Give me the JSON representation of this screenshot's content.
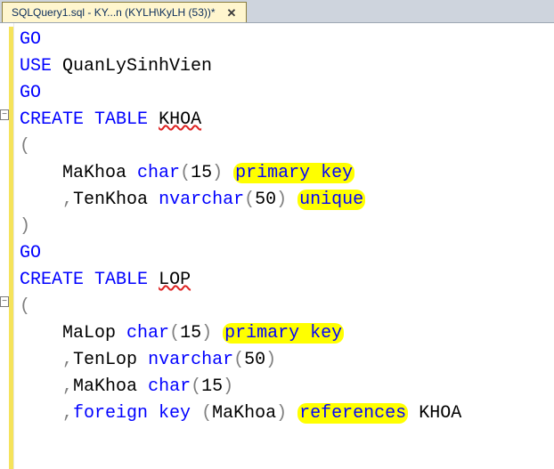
{
  "tab": {
    "label": "SQLQuery1.sql - KY...n (KYLH\\KyLH (53))*",
    "close_glyph": "✕"
  },
  "outline": {
    "collapse_glyph": "−"
  },
  "code": {
    "l1_go": "GO",
    "l2_use": "USE",
    "l2_db": "QuanLySinhVien",
    "l3_go": "GO",
    "l4_create": "CREATE",
    "l4_table": "TABLE",
    "l4_name": "KHOA",
    "l5_paren_open": "(",
    "l6_col": "MaKhoa",
    "l6_type": "char",
    "l6_len": "15",
    "l6_pk": "primary key",
    "l7_comma": ",",
    "l7_col": "TenKhoa",
    "l7_type": "nvarchar",
    "l7_len": "50",
    "l7_uq": "unique",
    "l8_paren_close": ")",
    "l9_go": "GO",
    "l10_create": "CREATE",
    "l10_table": "TABLE",
    "l10_name": "LOP",
    "l11_paren_open": "(",
    "l12_col": "MaLop",
    "l12_type": "char",
    "l12_len": "15",
    "l12_pk": "primary key",
    "l13_comma": ",",
    "l13_col": "TenLop",
    "l13_type": "nvarchar",
    "l13_len": "50",
    "l14_comma": ",",
    "l14_col": "MaKhoa",
    "l14_type": "char",
    "l14_len": "15",
    "l15_comma": ",",
    "l15_fk": "foreign key",
    "l15_po": "(",
    "l15_ref_col": "MaKhoa",
    "l15_pc": ")",
    "l15_refs": "references",
    "l15_ref_tbl": "KHOA"
  }
}
